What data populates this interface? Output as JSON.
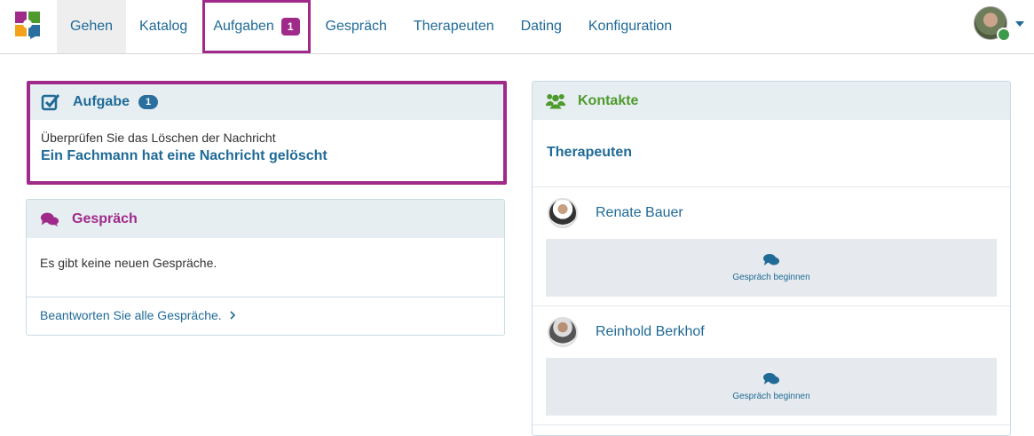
{
  "nav": {
    "items": [
      {
        "label": "Gehen"
      },
      {
        "label": "Katalog"
      },
      {
        "label": "Aufgaben",
        "badge": "1"
      },
      {
        "label": "Gespräch"
      },
      {
        "label": "Therapeuten"
      },
      {
        "label": "Dating"
      },
      {
        "label": "Konfiguration"
      }
    ]
  },
  "task": {
    "title": "Aufgabe",
    "badge": "1",
    "subtitle": "Überprüfen Sie das Löschen der Nachricht",
    "link": "Ein Fachmann hat eine Nachricht gelöscht"
  },
  "chat": {
    "title": "Gespräch",
    "empty": "Es gibt keine neuen Gespräche.",
    "footer": "Beantworten Sie alle Gespräche."
  },
  "contacts": {
    "title": "Kontakte",
    "section": "Therapeuten",
    "people": [
      {
        "name": "Renate Bauer",
        "button": "Gespräch beginnen"
      },
      {
        "name": "Reinhold Berkhof",
        "button": "Gespräch beginnen"
      }
    ]
  },
  "colors": {
    "accent_purple": "#a02a8a",
    "link_blue": "#1f6a96",
    "contacts_green": "#4f9a2c"
  }
}
